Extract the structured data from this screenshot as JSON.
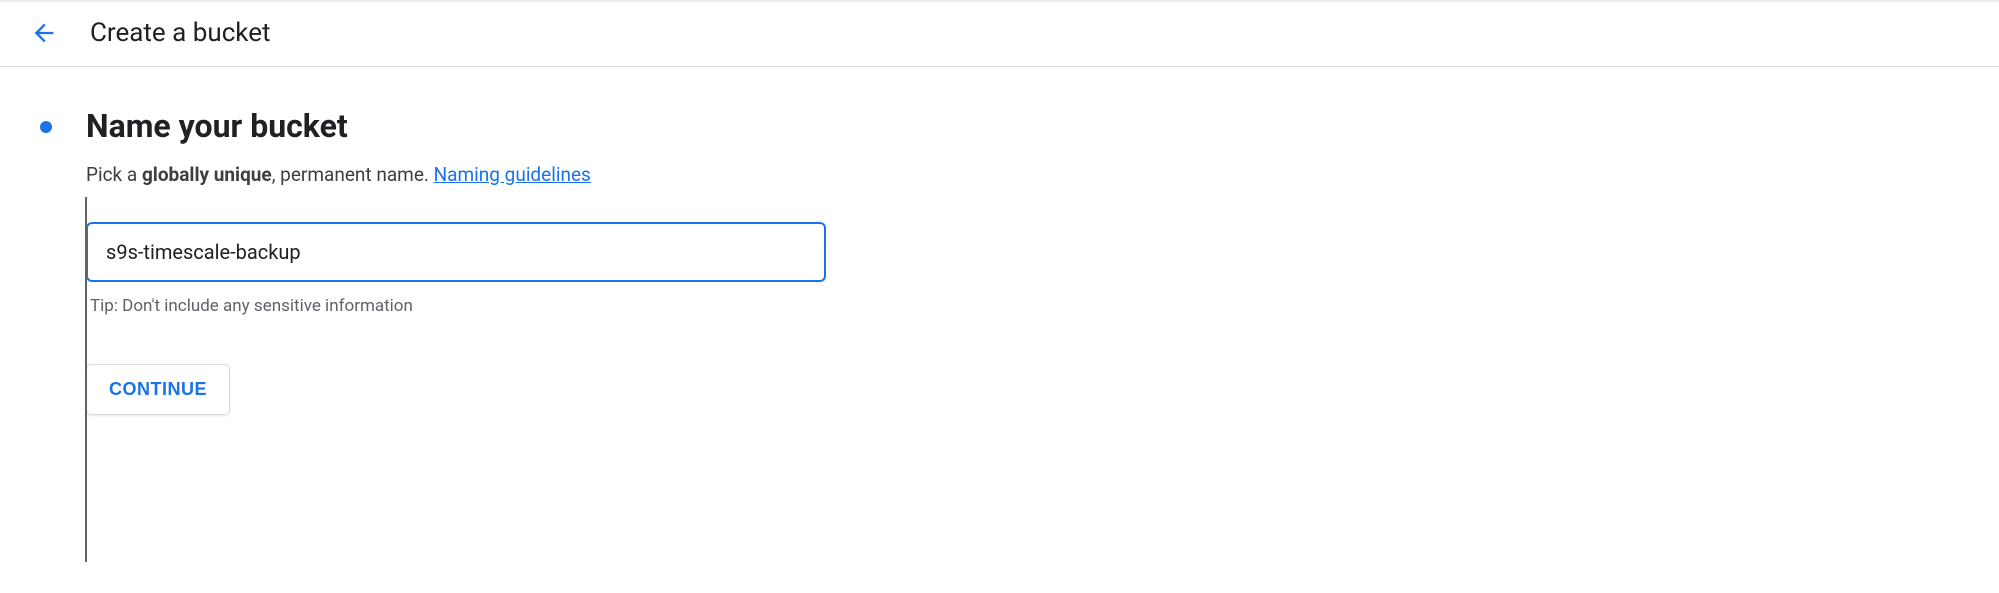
{
  "header": {
    "title": "Create a bucket"
  },
  "section": {
    "title": "Name your bucket",
    "hint_prefix": "Pick a ",
    "hint_bold": "globally unique",
    "hint_suffix": ", permanent name. ",
    "guidelines_link": "Naming guidelines",
    "input_value": "s9s-timescale-backup",
    "tip": "Tip: Don't include any sensitive information",
    "continue_label": "CONTINUE"
  },
  "colors": {
    "accent": "#1a73e8"
  }
}
